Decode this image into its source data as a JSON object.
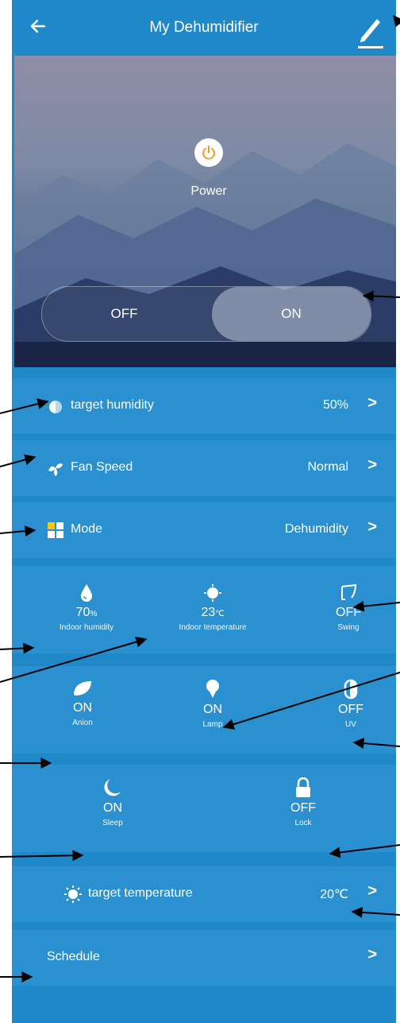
{
  "header": {
    "title": "My Dehumidifier",
    "back_icon": "arrow-left-icon",
    "edit_icon": "pencil-icon"
  },
  "power": {
    "label": "Power",
    "off_label": "OFF",
    "on_label": "ON",
    "state": "ON"
  },
  "settings": {
    "target_humidity": {
      "label": "target humidity",
      "value": "50%"
    },
    "fan_speed": {
      "label": "Fan Speed",
      "value": "Normal"
    },
    "mode": {
      "label": "Mode",
      "value": "Dehumidity"
    }
  },
  "readings": {
    "humidity": {
      "value": "70",
      "unit": "%",
      "label": "Indoor humidity"
    },
    "temperature": {
      "value": "23",
      "unit": "℃",
      "label": "Indoor temperature"
    },
    "swing": {
      "value": "OFF",
      "label": "Swing"
    }
  },
  "features": {
    "anion": {
      "value": "ON",
      "label": "Anion"
    },
    "lamp": {
      "value": "ON",
      "label": "Lamp"
    },
    "uv": {
      "value": "OFF",
      "label": "UV"
    },
    "sleep": {
      "value": "ON",
      "label": "Sleep"
    },
    "lock": {
      "value": "OFF",
      "label": "Lock"
    }
  },
  "target_temperature": {
    "label": "target temperature",
    "value": "20℃"
  },
  "schedule": {
    "label": "Schedule"
  },
  "colors": {
    "background": "#1f88c9",
    "row": "#2a90cf",
    "text": "#ffffff",
    "arrow": "#000000"
  }
}
